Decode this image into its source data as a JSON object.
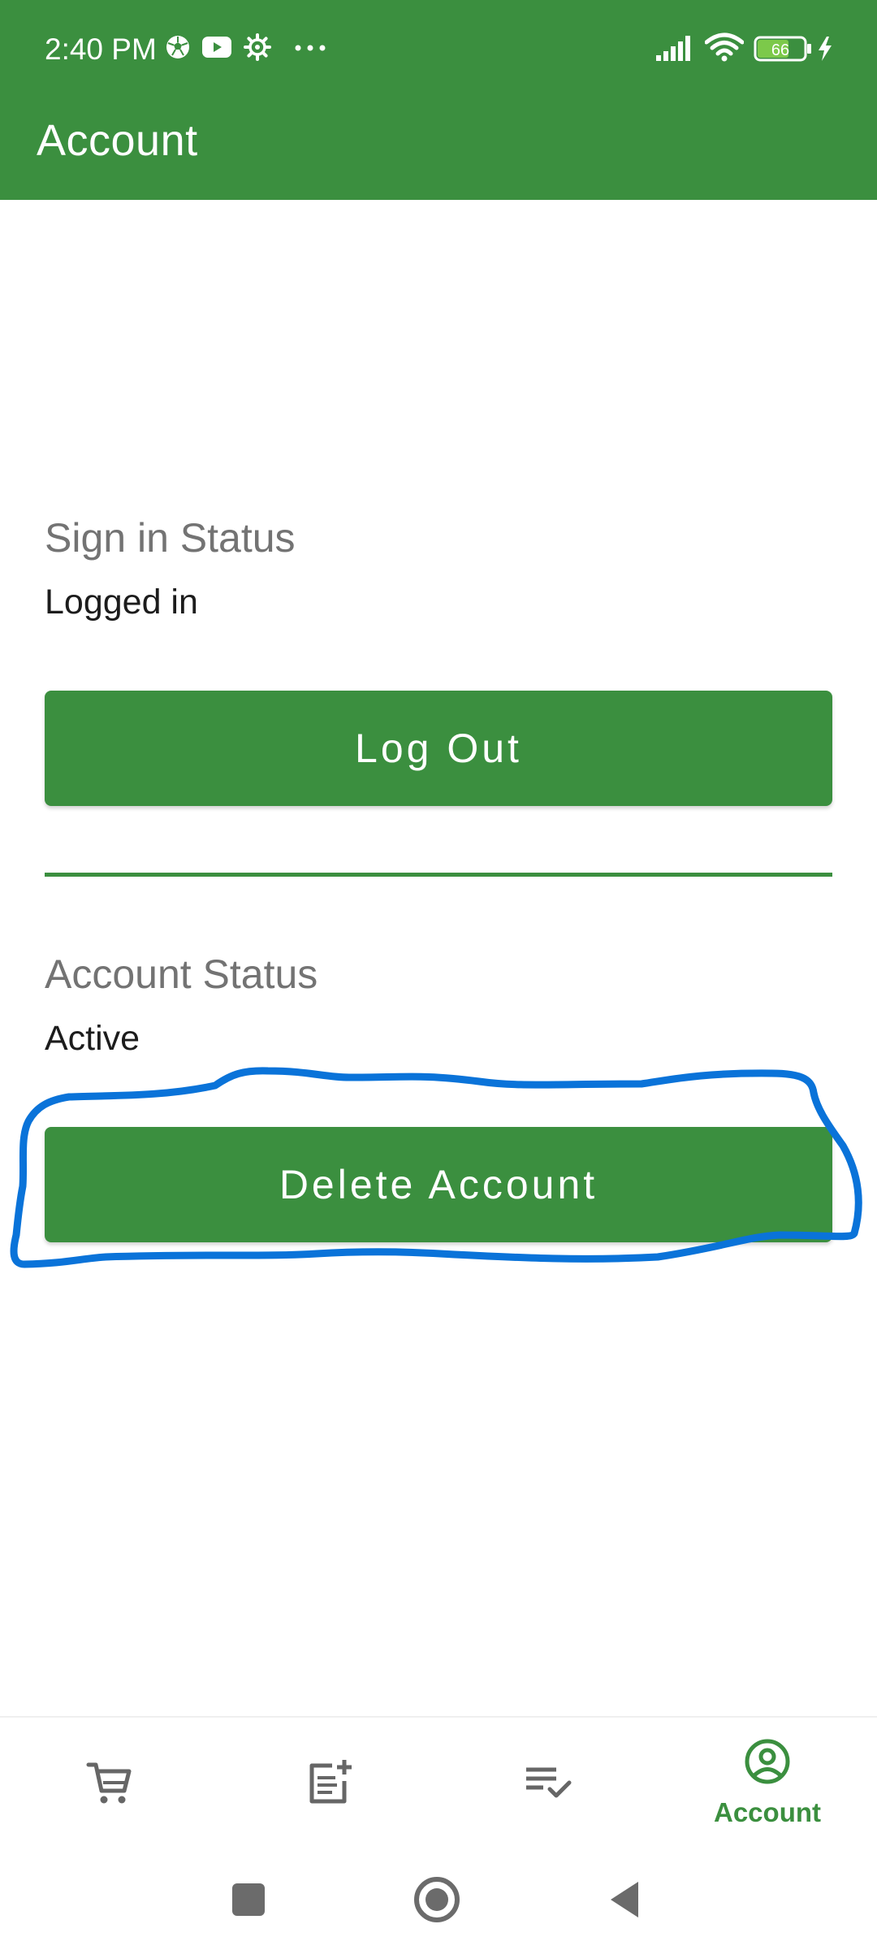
{
  "status_bar": {
    "time": "2:40 PM",
    "icons": [
      "soccer-ball-icon",
      "youtube-icon",
      "settings-gear-icon",
      "more-dots-icon",
      "signal-icon",
      "wifi-icon",
      "battery-icon",
      "charging-icon"
    ],
    "battery_level": "66"
  },
  "app_bar": {
    "title": "Account"
  },
  "sign_in": {
    "label": "Sign in Status",
    "value": "Logged in",
    "button_label": "Log Out"
  },
  "account": {
    "label": "Account Status",
    "value": "Active",
    "button_label": "Delete Account"
  },
  "annotation": {
    "color": "#0a73d9",
    "target": "delete-account-button"
  },
  "bottom_nav": {
    "items": [
      {
        "icon": "cart-icon",
        "label": "",
        "active": false
      },
      {
        "icon": "add-list-icon",
        "label": "",
        "active": false
      },
      {
        "icon": "checklist-icon",
        "label": "",
        "active": false
      },
      {
        "icon": "account-circle-icon",
        "label": "Account",
        "active": true
      }
    ]
  },
  "system_nav": {
    "buttons": [
      "recents-icon",
      "home-icon",
      "back-icon"
    ]
  },
  "colors": {
    "primary": "#3b8f3f",
    "label_gray": "#737373",
    "text_dark": "#1c1c1c",
    "nav_icon_gray": "#666666",
    "annotation_blue": "#0a73d9"
  }
}
